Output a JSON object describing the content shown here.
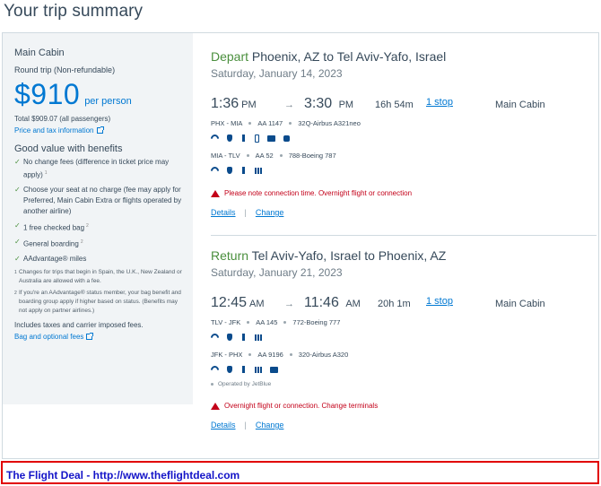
{
  "page": {
    "title": "Your trip summary"
  },
  "sidebar": {
    "cabin": "Main Cabin",
    "trip_type": "Round trip (Non-refundable)",
    "price": "$910",
    "per_person": "per person",
    "total": "Total $909.07 (all passengers)",
    "price_tax_link": "Price and tax information",
    "benefits_title": "Good value with benefits",
    "benefits": [
      {
        "text": "No change fees (difference in ticket price may apply)",
        "note": "1"
      },
      {
        "text": "Choose your seat at no charge (fee may apply for Preferred, Main Cabin Extra or flights operated by another airline)",
        "note": ""
      },
      {
        "text": "1 free checked bag",
        "note": "2"
      },
      {
        "text": "General boarding",
        "note": "2"
      },
      {
        "text": "AAdvantage® miles",
        "note": ""
      }
    ],
    "footnotes": [
      {
        "num": "1",
        "text": "Changes for trips that begin in Spain, the U.K., New Zealand or Australia are allowed with a fee."
      },
      {
        "num": "2",
        "text": "If you're an AAdvantage® status member, your bag benefit and boarding group apply if higher based on status. (Benefits may not apply on partner airlines.)"
      }
    ],
    "taxes_note": "Includes taxes and carrier imposed fees.",
    "bag_link": "Bag and optional fees"
  },
  "depart": {
    "direction": "Depart",
    "route": "Phoenix, AZ to Tel Aviv-Yafo, Israel",
    "date": "Saturday, January 14, 2023",
    "dep_time": "1:36",
    "dep_ampm": "PM",
    "arr_time": "3:30",
    "arr_ampm": "PM",
    "duration": "16h 54m",
    "stops": "1 stop",
    "cabin": "Main Cabin",
    "segments": [
      {
        "route": "PHX - MIA",
        "flight": "AA 1147",
        "aircraft": "32Q-Airbus A321neo"
      },
      {
        "route": "MIA - TLV",
        "flight": "AA 52",
        "aircraft": "788-Boeing 787"
      }
    ],
    "warning": "Please note connection time. Overnight flight or connection",
    "details_link": "Details",
    "change_link": "Change"
  },
  "return": {
    "direction": "Return",
    "route": "Tel Aviv-Yafo, Israel to Phoenix, AZ",
    "date": "Saturday, January 21, 2023",
    "dep_time": "12:45",
    "dep_ampm": "AM",
    "arr_time": "11:46",
    "arr_ampm": "AM",
    "duration": "20h 1m",
    "stops": "1 stop",
    "cabin": "Main Cabin",
    "segments": [
      {
        "route": "TLV - JFK",
        "flight": "AA 145",
        "aircraft": "772-Boeing 777"
      },
      {
        "route": "JFK - PHX",
        "flight": "AA 9196",
        "aircraft": "320-Airbus A320"
      }
    ],
    "operated_by": "Operated by JetBlue",
    "warning": "Overnight flight or connection. Change terminals",
    "details_link": "Details",
    "change_link": "Change"
  },
  "banner": {
    "text": "The Flight Deal - http://www.theflightdeal.com"
  },
  "colors": {
    "accent": "#0078d2",
    "success": "#4a8f3d",
    "warning": "#c30019",
    "banner_border": "#e10000",
    "banner_text": "#1414c8"
  }
}
